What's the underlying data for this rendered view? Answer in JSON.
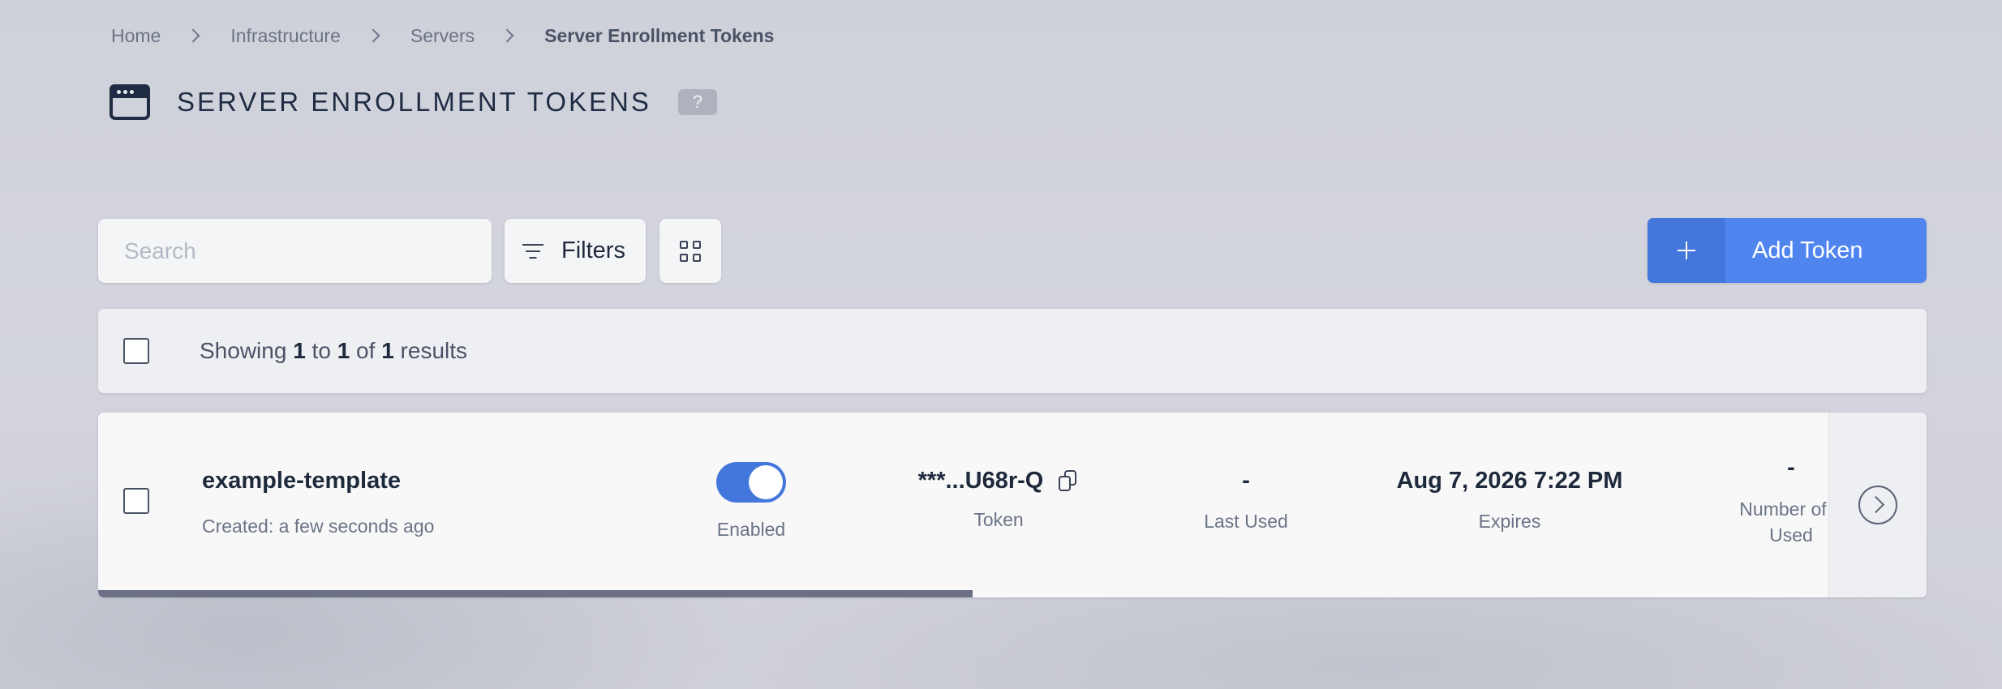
{
  "breadcrumb": {
    "items": [
      "Home",
      "Infrastructure",
      "Servers",
      "Server Enrollment Tokens"
    ]
  },
  "header": {
    "title": "SERVER ENROLLMENT TOKENS",
    "help": "?",
    "icon": "browser-window-icon"
  },
  "toolbar": {
    "search_placeholder": "Search",
    "filters_label": "Filters",
    "add_label": "Add Token"
  },
  "results": {
    "prefix": "Showing",
    "from": "1",
    "to_word": "to",
    "to": "1",
    "of_word": "of",
    "total": "1",
    "suffix": "results"
  },
  "tokens": [
    {
      "name": "example-template",
      "created_label": "Created:",
      "created_value": "a few seconds ago",
      "enabled": true,
      "status_label": "Enabled",
      "token_value": "***...U68r-Q",
      "token_label": "Token",
      "last_used_value": "-",
      "last_used_label": "Last Used",
      "expires_value": "Aug 7, 2026 7:22 PM",
      "expires_label": "Expires",
      "uses_value": "-",
      "uses_label_line1": "Number of T",
      "uses_label_line2": "Used"
    }
  ],
  "colors": {
    "accent": "#4477db",
    "accent_light": "#5084ef",
    "text_dark": "#1e2a3b",
    "text_muted": "#6b7486"
  }
}
